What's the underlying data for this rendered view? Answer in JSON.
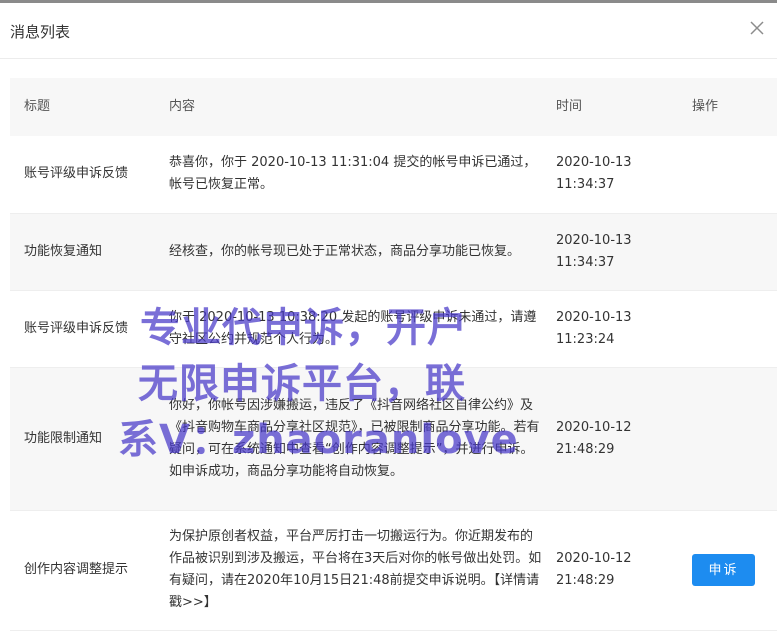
{
  "dialog": {
    "title": "消息列表",
    "close_icon": "close-icon"
  },
  "table": {
    "headers": [
      "标题",
      "内容",
      "时间",
      "操作"
    ],
    "rows": [
      {
        "title": "账号评级申诉反馈",
        "content": "恭喜你，你于 2020-10-13 11:31:04 提交的帐号申诉已通过，帐号已恢复正常。",
        "date": "2020-10-13",
        "time": "11:34:37",
        "action": ""
      },
      {
        "title": "功能恢复通知",
        "content": "经核查，你的帐号现已处于正常状态，商品分享功能已恢复。",
        "date": "2020-10-13",
        "time": "11:34:37",
        "action": ""
      },
      {
        "title": "账号评级申诉反馈",
        "content": "你于 2020-10-13 10:38:20 发起的账号评级申诉未通过，请遵守社区公约并规范个人行为。",
        "date": "2020-10-13",
        "time": "11:23:24",
        "action": ""
      },
      {
        "title": "功能限制通知",
        "content": "你好，你帐号因涉嫌搬运，违反了《抖音网络社区自律公约》及《抖音购物车商品分享社区规范》，已被限制商品分享功能。若有疑问，可在系统通知中查看“创作内容调整提示”，并进行申诉。如申诉成功，商品分享功能将自动恢复。",
        "date": "2020-10-12",
        "time": "21:48:29",
        "action": ""
      },
      {
        "title": "创作内容调整提示",
        "content": "为保护原创者权益，平台严厉打击一切搬运行为。你近期发布的作品被识别到涉及搬运，平台将在3天后对你的帐号做出处罚。如有疑问，请在2020年10月15日21:48前提交申诉说明。",
        "link": "【详情请戳>>】",
        "date": "2020-10-12",
        "time": "21:48:29",
        "action": "申诉"
      }
    ]
  },
  "watermark": {
    "line1": "专业代申诉，开户",
    "line2": "无限申诉平台，联",
    "line3": "系V：zhaoranlove"
  },
  "colors": {
    "accent": "#1d8cf0",
    "row_alt": "#f7f7f7",
    "watermark": "#4637c8"
  }
}
